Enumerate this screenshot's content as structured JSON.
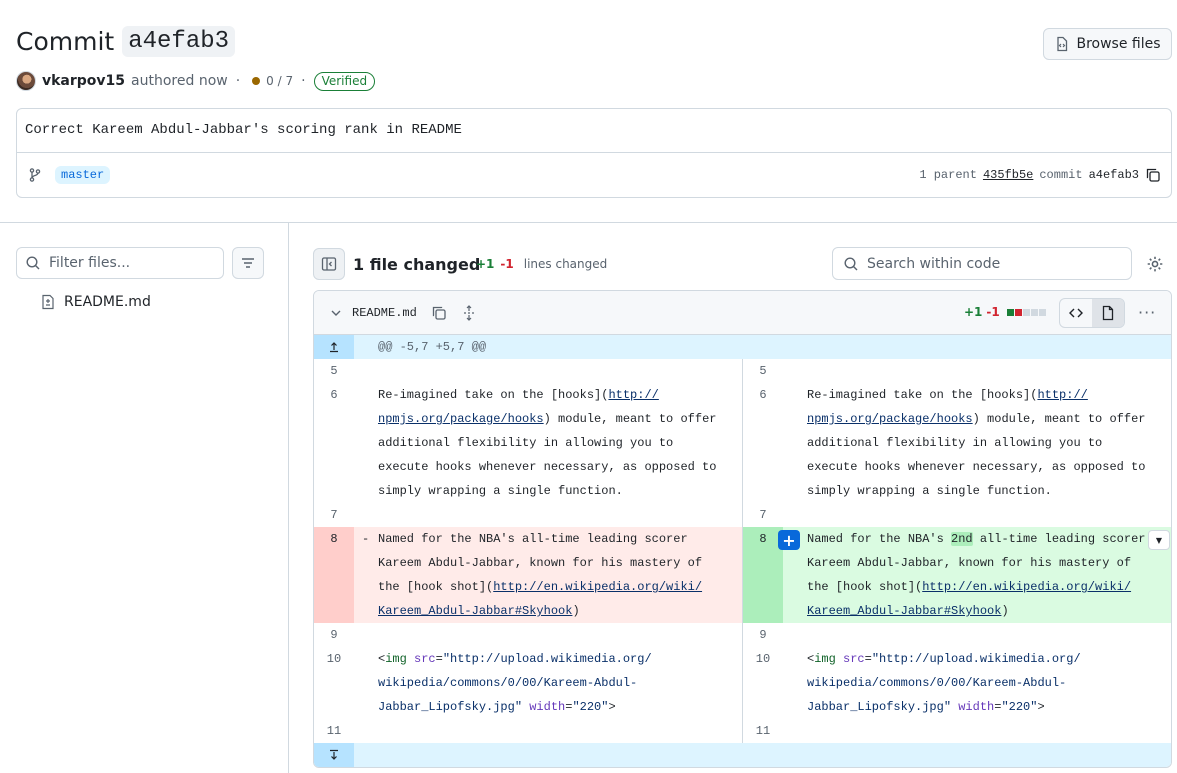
{
  "header": {
    "title_prefix": "Commit",
    "title_sha": "a4efab3",
    "browse_files": "Browse files",
    "author": "vkarpov15",
    "authored_text": "authored now",
    "separator": "·",
    "checks": "0 / 7",
    "verified": "Verified",
    "status_color": "#9a6700"
  },
  "commit": {
    "message": "Correct Kareem Abdul-Jabbar's scoring rank in README",
    "branch": "master",
    "parent_label": "1 parent",
    "parent_sha": "435fb5e",
    "commit_label": "commit",
    "commit_sha": "a4efab3"
  },
  "sidebar": {
    "filter_placeholder": "Filter files...",
    "files": [
      {
        "name": "README.md"
      }
    ]
  },
  "toolbar": {
    "files_changed": "1 file changed",
    "additions": "+1",
    "deletions": "-1",
    "lines_changed": "lines changed",
    "search_placeholder": "Search within code"
  },
  "file": {
    "name": "README.md",
    "additions": "+1",
    "deletions": "-1",
    "hunk_header": "@@ -5,7 +5,7 @@",
    "colors": {
      "add": "#1a7f37",
      "del": "#d1242f",
      "neutral": "#d1d9e0"
    }
  },
  "diff": {
    "line5": "5",
    "line6": "6",
    "line7": "7",
    "line8": "8",
    "line9": "9",
    "line10": "10",
    "line11": "11",
    "l6_pre": "Re-imagined take on the [hooks](",
    "l6_link": "http://\nnpmjs.org/package/hooks",
    "l6_post": ") module, meant to offer\nadditional flexibility in allowing you to\nexecute hooks whenever necessary, as opposed to\nsimply wrapping a single function.",
    "del_sign": "-",
    "l8_old_pre": "Named for the NBA's all-time leading scorer\nKareem Abdul-Jabbar, known for his mastery of\nthe [hook shot](",
    "l8_link": "http://en.wikipedia.org/wiki/\nKareem_Abdul-Jabbar#Skyhook",
    "l8_post": ")",
    "l8_new_a": "Named for the NBA's ",
    "l8_new_word": "2nd",
    "l8_new_b": " all-time leading scorer\nKareem Abdul-Jabbar, known for his mastery of\nthe [hook shot](",
    "l10_lt": "<",
    "l10_tag": "img",
    "l10_attr1": "src",
    "l10_eq": "=",
    "l10_val1": "\"http://upload.wikimedia.org/\nwikipedia/commons/0/00/Kareem-Abdul-\nJabbar_Lipofsky.jpg\"",
    "l10_attr2": "width",
    "l10_val2": "\"220\"",
    "l10_gt": ">"
  }
}
